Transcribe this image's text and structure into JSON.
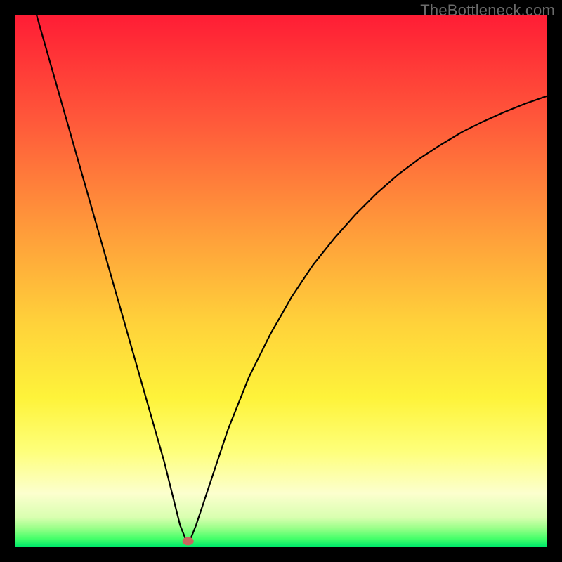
{
  "watermark": "TheBottleneck.com",
  "chart_data": {
    "type": "line",
    "title": "",
    "xlabel": "",
    "ylabel": "",
    "xlim": [
      0,
      100
    ],
    "ylim": [
      0,
      100
    ],
    "grid": false,
    "legend": false,
    "description": "V-shaped bottleneck curve with minimum near x≈32 against a vertical rainbow gradient (red→orange→yellow→green) and a thin bright green band at the bottom. A small red marker sits at the curve minimum.",
    "gradient_stops": [
      {
        "offset": 0.0,
        "color": "#ff1d35"
      },
      {
        "offset": 0.2,
        "color": "#ff593a"
      },
      {
        "offset": 0.4,
        "color": "#ff9a3a"
      },
      {
        "offset": 0.58,
        "color": "#ffd23a"
      },
      {
        "offset": 0.72,
        "color": "#fef33a"
      },
      {
        "offset": 0.82,
        "color": "#feff7a"
      },
      {
        "offset": 0.9,
        "color": "#fcffce"
      },
      {
        "offset": 0.945,
        "color": "#d9ffb0"
      },
      {
        "offset": 0.965,
        "color": "#9cff8a"
      },
      {
        "offset": 0.985,
        "color": "#45ff6a"
      },
      {
        "offset": 1.0,
        "color": "#00e96a"
      }
    ],
    "series": [
      {
        "name": "bottleneck-curve",
        "x": [
          4,
          6,
          8,
          10,
          12,
          14,
          16,
          18,
          20,
          22,
          24,
          26,
          28,
          29,
          30,
          31,
          32,
          33,
          34,
          36,
          38,
          40,
          44,
          48,
          52,
          56,
          60,
          64,
          68,
          72,
          76,
          80,
          84,
          88,
          92,
          96,
          100
        ],
        "y": [
          100,
          93,
          86,
          79,
          72,
          65,
          58,
          51,
          44,
          37,
          30,
          23,
          16,
          12,
          8,
          4,
          1.5,
          1.5,
          4,
          10,
          16,
          22,
          32,
          40,
          47,
          53,
          58,
          62.5,
          66.5,
          70,
          73,
          75.6,
          78,
          80,
          81.8,
          83.4,
          84.8
        ]
      }
    ],
    "marker": {
      "x": 32.5,
      "y": 1.0,
      "color": "#c9655e"
    }
  }
}
